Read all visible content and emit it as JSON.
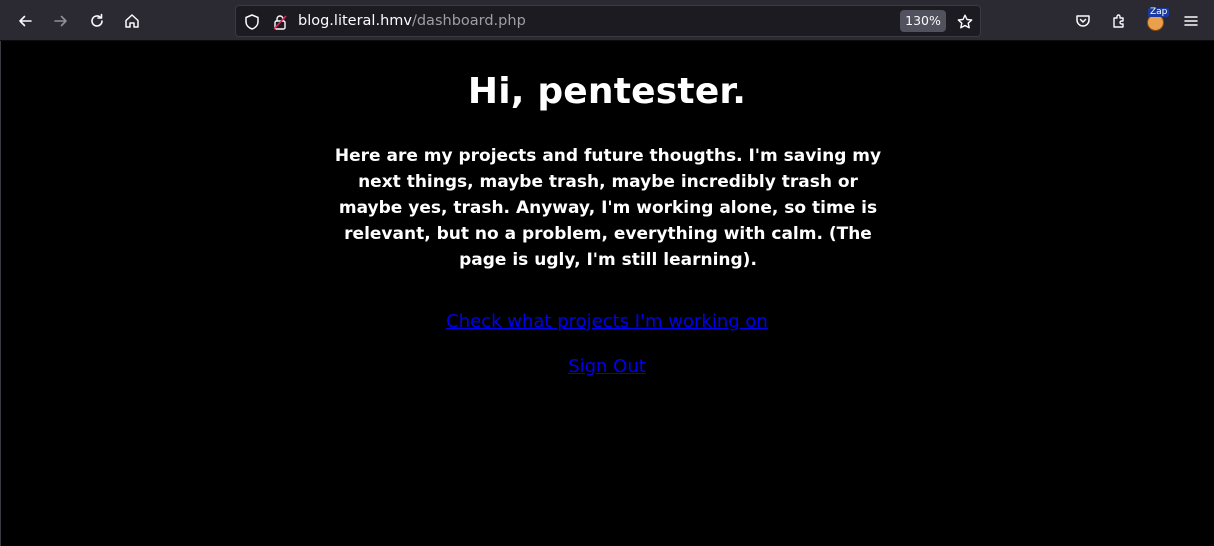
{
  "browser": {
    "url_host": "blog.literal.hmv",
    "url_path": "/dashboard.php",
    "zoom": "130%",
    "extension_badge": "Zap",
    "icons": [
      "back-icon",
      "forward-icon",
      "reload-icon",
      "home-icon",
      "shield-icon",
      "lock-icon",
      "star-icon",
      "pocket-icon",
      "extensions-icon",
      "zap-extension-icon",
      "menu-icon"
    ]
  },
  "page": {
    "heading": "Hi, pentester.",
    "intro": "Here are my projects and future thougths. I'm saving my next things, maybe trash, maybe incredibly trash or maybe yes, trash. Anyway, I'm working alone, so time is relevant, but no a problem, everything with calm. (The page is ugly, I'm still learning).",
    "projects_link": "Check what projects I'm working on",
    "signout_link": "Sign Out",
    "link_color": "#0000ee",
    "background": "#000000"
  }
}
